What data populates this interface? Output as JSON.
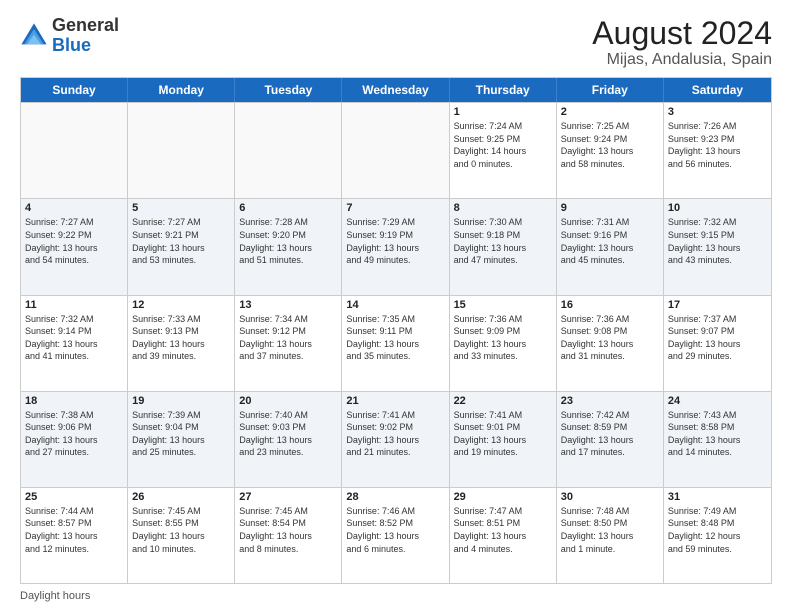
{
  "header": {
    "title": "August 2024",
    "subtitle": "Mijas, Andalusia, Spain"
  },
  "logo": {
    "line1": "General",
    "line2": "Blue"
  },
  "days": [
    "Sunday",
    "Monday",
    "Tuesday",
    "Wednesday",
    "Thursday",
    "Friday",
    "Saturday"
  ],
  "footer": "Daylight hours",
  "weeks": [
    [
      {
        "day": "",
        "info": ""
      },
      {
        "day": "",
        "info": ""
      },
      {
        "day": "",
        "info": ""
      },
      {
        "day": "",
        "info": ""
      },
      {
        "day": "1",
        "info": "Sunrise: 7:24 AM\nSunset: 9:25 PM\nDaylight: 14 hours\nand 0 minutes."
      },
      {
        "day": "2",
        "info": "Sunrise: 7:25 AM\nSunset: 9:24 PM\nDaylight: 13 hours\nand 58 minutes."
      },
      {
        "day": "3",
        "info": "Sunrise: 7:26 AM\nSunset: 9:23 PM\nDaylight: 13 hours\nand 56 minutes."
      }
    ],
    [
      {
        "day": "4",
        "info": "Sunrise: 7:27 AM\nSunset: 9:22 PM\nDaylight: 13 hours\nand 54 minutes."
      },
      {
        "day": "5",
        "info": "Sunrise: 7:27 AM\nSunset: 9:21 PM\nDaylight: 13 hours\nand 53 minutes."
      },
      {
        "day": "6",
        "info": "Sunrise: 7:28 AM\nSunset: 9:20 PM\nDaylight: 13 hours\nand 51 minutes."
      },
      {
        "day": "7",
        "info": "Sunrise: 7:29 AM\nSunset: 9:19 PM\nDaylight: 13 hours\nand 49 minutes."
      },
      {
        "day": "8",
        "info": "Sunrise: 7:30 AM\nSunset: 9:18 PM\nDaylight: 13 hours\nand 47 minutes."
      },
      {
        "day": "9",
        "info": "Sunrise: 7:31 AM\nSunset: 9:16 PM\nDaylight: 13 hours\nand 45 minutes."
      },
      {
        "day": "10",
        "info": "Sunrise: 7:32 AM\nSunset: 9:15 PM\nDaylight: 13 hours\nand 43 minutes."
      }
    ],
    [
      {
        "day": "11",
        "info": "Sunrise: 7:32 AM\nSunset: 9:14 PM\nDaylight: 13 hours\nand 41 minutes."
      },
      {
        "day": "12",
        "info": "Sunrise: 7:33 AM\nSunset: 9:13 PM\nDaylight: 13 hours\nand 39 minutes."
      },
      {
        "day": "13",
        "info": "Sunrise: 7:34 AM\nSunset: 9:12 PM\nDaylight: 13 hours\nand 37 minutes."
      },
      {
        "day": "14",
        "info": "Sunrise: 7:35 AM\nSunset: 9:11 PM\nDaylight: 13 hours\nand 35 minutes."
      },
      {
        "day": "15",
        "info": "Sunrise: 7:36 AM\nSunset: 9:09 PM\nDaylight: 13 hours\nand 33 minutes."
      },
      {
        "day": "16",
        "info": "Sunrise: 7:36 AM\nSunset: 9:08 PM\nDaylight: 13 hours\nand 31 minutes."
      },
      {
        "day": "17",
        "info": "Sunrise: 7:37 AM\nSunset: 9:07 PM\nDaylight: 13 hours\nand 29 minutes."
      }
    ],
    [
      {
        "day": "18",
        "info": "Sunrise: 7:38 AM\nSunset: 9:06 PM\nDaylight: 13 hours\nand 27 minutes."
      },
      {
        "day": "19",
        "info": "Sunrise: 7:39 AM\nSunset: 9:04 PM\nDaylight: 13 hours\nand 25 minutes."
      },
      {
        "day": "20",
        "info": "Sunrise: 7:40 AM\nSunset: 9:03 PM\nDaylight: 13 hours\nand 23 minutes."
      },
      {
        "day": "21",
        "info": "Sunrise: 7:41 AM\nSunset: 9:02 PM\nDaylight: 13 hours\nand 21 minutes."
      },
      {
        "day": "22",
        "info": "Sunrise: 7:41 AM\nSunset: 9:01 PM\nDaylight: 13 hours\nand 19 minutes."
      },
      {
        "day": "23",
        "info": "Sunrise: 7:42 AM\nSunset: 8:59 PM\nDaylight: 13 hours\nand 17 minutes."
      },
      {
        "day": "24",
        "info": "Sunrise: 7:43 AM\nSunset: 8:58 PM\nDaylight: 13 hours\nand 14 minutes."
      }
    ],
    [
      {
        "day": "25",
        "info": "Sunrise: 7:44 AM\nSunset: 8:57 PM\nDaylight: 13 hours\nand 12 minutes."
      },
      {
        "day": "26",
        "info": "Sunrise: 7:45 AM\nSunset: 8:55 PM\nDaylight: 13 hours\nand 10 minutes."
      },
      {
        "day": "27",
        "info": "Sunrise: 7:45 AM\nSunset: 8:54 PM\nDaylight: 13 hours\nand 8 minutes."
      },
      {
        "day": "28",
        "info": "Sunrise: 7:46 AM\nSunset: 8:52 PM\nDaylight: 13 hours\nand 6 minutes."
      },
      {
        "day": "29",
        "info": "Sunrise: 7:47 AM\nSunset: 8:51 PM\nDaylight: 13 hours\nand 4 minutes."
      },
      {
        "day": "30",
        "info": "Sunrise: 7:48 AM\nSunset: 8:50 PM\nDaylight: 13 hours\nand 1 minute."
      },
      {
        "day": "31",
        "info": "Sunrise: 7:49 AM\nSunset: 8:48 PM\nDaylight: 12 hours\nand 59 minutes."
      }
    ]
  ]
}
